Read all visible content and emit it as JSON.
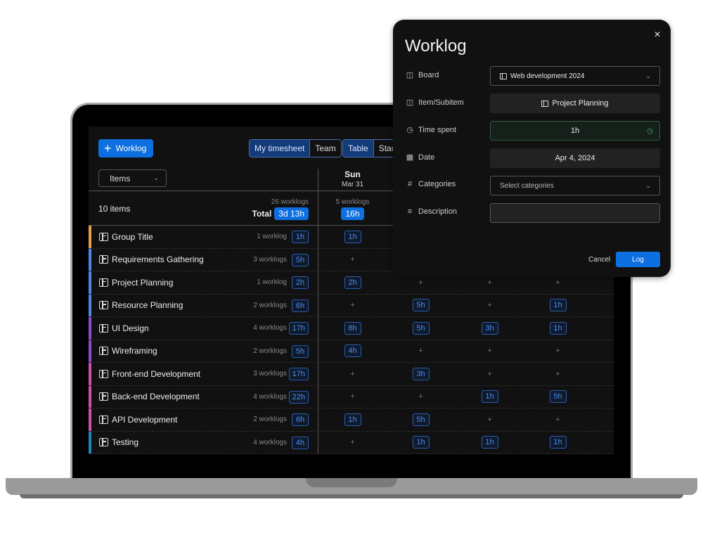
{
  "toolbar": {
    "add_worklog_label": "Worklog",
    "view_toggle": [
      "My timesheet",
      "Team"
    ],
    "view_toggle_active": "My timesheet",
    "layout_toggle": [
      "Table",
      "Stac"
    ],
    "layout_toggle_active": "Table",
    "group_by_select": "Items"
  },
  "days": [
    {
      "name": "Sun",
      "date": "Mar 31",
      "worklogs": "5 worklogs",
      "total": "16h"
    }
  ],
  "summary": {
    "item_count": "10 items",
    "worklogs": "26 worklogs",
    "total_label": "Total",
    "total": "3d 13h"
  },
  "rows": [
    {
      "name": "Group Title",
      "color": "#e8a14a",
      "count": "1 worklog",
      "total": "1h",
      "cells": [
        "1h",
        null,
        null,
        null
      ],
      "cells_hidden_by_modal": true
    },
    {
      "name": "Requirements Gathering",
      "color": "#4f86e8",
      "count": "3 worklogs",
      "total": "5h",
      "cells": [
        "+",
        null,
        null,
        null
      ],
      "cells_hidden_by_modal": true
    },
    {
      "name": "Project Planning",
      "color": "#4f86e8",
      "count": "1 worklog",
      "total": "2h",
      "cells": [
        "2h",
        "+",
        "+",
        "+"
      ]
    },
    {
      "name": "Resource Planning",
      "color": "#4f86e8",
      "count": "2 worklogs",
      "total": "6h",
      "cells": [
        "+",
        "5h",
        "+",
        "1h"
      ]
    },
    {
      "name": "UI Design",
      "color": "#8a4fc8",
      "count": "4 worklogs",
      "total": "17h",
      "cells": [
        "8h",
        "5h",
        "3h",
        "1h"
      ]
    },
    {
      "name": "Wireframing",
      "color": "#8a4fc8",
      "count": "2 worklogs",
      "total": "5h",
      "cells": [
        "4h",
        "+",
        "+",
        "+"
      ]
    },
    {
      "name": "Front-end Development",
      "color": "#d04fb0",
      "count": "3 worklogs",
      "total": "17h",
      "cells": [
        "+",
        "3h",
        "+",
        "+"
      ]
    },
    {
      "name": "Back-end Development",
      "color": "#d04fb0",
      "count": "4 worklogs",
      "total": "22h",
      "cells": [
        "+",
        "+",
        "1h",
        "5h"
      ]
    },
    {
      "name": "API Development",
      "color": "#d04fb0",
      "count": "2 worklogs",
      "total": "6h",
      "cells": [
        "1h",
        "5h",
        "+",
        "+"
      ]
    },
    {
      "name": "Testing",
      "color": "#1f86b8",
      "count": "4 worklogs",
      "total": "4h",
      "cells": [
        "+",
        "1h",
        "1h",
        "1h"
      ]
    }
  ],
  "modal": {
    "title": "Worklog",
    "close_icon": "close-icon",
    "fields": {
      "board": {
        "label": "Board",
        "value": "Web development 2024"
      },
      "item": {
        "label": "Item/Subitem",
        "value": "Project Planning"
      },
      "time": {
        "label": "Time spent",
        "value": "1h"
      },
      "date": {
        "label": "Date",
        "value": "Apr 4, 2024"
      },
      "categories": {
        "label": "Categories",
        "placeholder": "Select categories"
      },
      "description": {
        "label": "Description",
        "value": ""
      }
    },
    "cancel_label": "Cancel",
    "log_label": "Log"
  },
  "colors": {
    "accent": "#0d6fe0",
    "background": "#111111",
    "time_ok": "#3aa76d"
  }
}
